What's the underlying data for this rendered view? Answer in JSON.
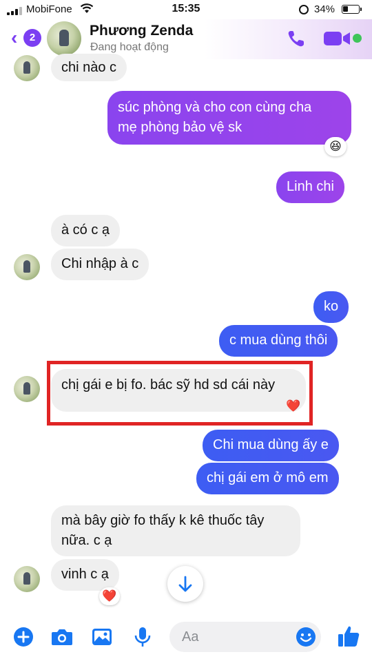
{
  "status_bar": {
    "carrier": "MobiFone",
    "time": "15:35",
    "battery": "34%",
    "battery_level": 0.34
  },
  "header": {
    "back_badge": "2",
    "contact_name": "Phương Zenda",
    "contact_status": "Đang hoạt động"
  },
  "messages": [
    {
      "side": "in",
      "text": "chi nào c"
    },
    {
      "side": "out",
      "lines": [
        "súc phòng và cho con cùng cha",
        "mẹ phòng bảo vệ sk"
      ],
      "reaction": "😆"
    },
    {
      "side": "out",
      "text": "Linh chi"
    },
    {
      "side": "in",
      "text": "à có c ạ"
    },
    {
      "side": "in",
      "text": "Chi nhập à c"
    },
    {
      "side": "out",
      "text": "ko"
    },
    {
      "side": "out",
      "text": "c mua dùng thôi"
    },
    {
      "side": "in",
      "text": "chị gái e bị fo. bác sỹ hd sd cái này",
      "reaction": "❤️",
      "highlighted": true
    },
    {
      "side": "out",
      "text": "Chi mua dùng ấy e"
    },
    {
      "side": "out",
      "text": "chị gái em ở mô em"
    },
    {
      "side": "in",
      "lines": [
        "mà bây giờ fo thấy k kê thuốc tây",
        "nữa. c ạ"
      ]
    },
    {
      "side": "in",
      "text": "vinh c ạ",
      "reaction": "❤️"
    }
  ],
  "composer": {
    "placeholder": "Aa"
  },
  "colors": {
    "accent": "#7b3ff2",
    "outgoing_start": "#6d4bf3",
    "outgoing_blue": "#3d5df3",
    "incoming": "#efefef",
    "highlight": "#e02424",
    "composer_icon": "#1877f2",
    "active": "#3fc55a"
  },
  "icons": [
    "signal-icon",
    "wifi-icon",
    "rotation-lock-icon",
    "battery-icon",
    "back-chevron-icon",
    "phone-icon",
    "video-camera-icon",
    "plus-icon",
    "camera-icon",
    "image-icon",
    "microphone-icon",
    "emoji-icon",
    "thumbs-up-icon",
    "arrow-down-icon"
  ]
}
